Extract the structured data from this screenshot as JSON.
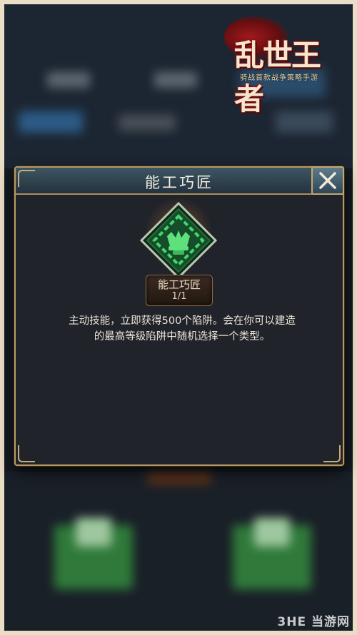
{
  "logo": {
    "title": "乱世王者",
    "subtitle": "骑战首款战争策略手游"
  },
  "dialog": {
    "title": "能工巧匠",
    "close_icon": "close-x-icon"
  },
  "skill": {
    "name": "能工巧匠",
    "level": "1/1",
    "icon": "chain-trap-diamond-icon"
  },
  "description": {
    "line1": "主动技能，立即获得500个陷阱。会在你可以建造",
    "line2": "的最高等级陷阱中随机选择一个类型。"
  },
  "watermark": "3HE 当游网",
  "colors": {
    "accent_gold": "#b79a62",
    "header_teal": "#3e5563",
    "skill_green": "#2fbf5a"
  }
}
